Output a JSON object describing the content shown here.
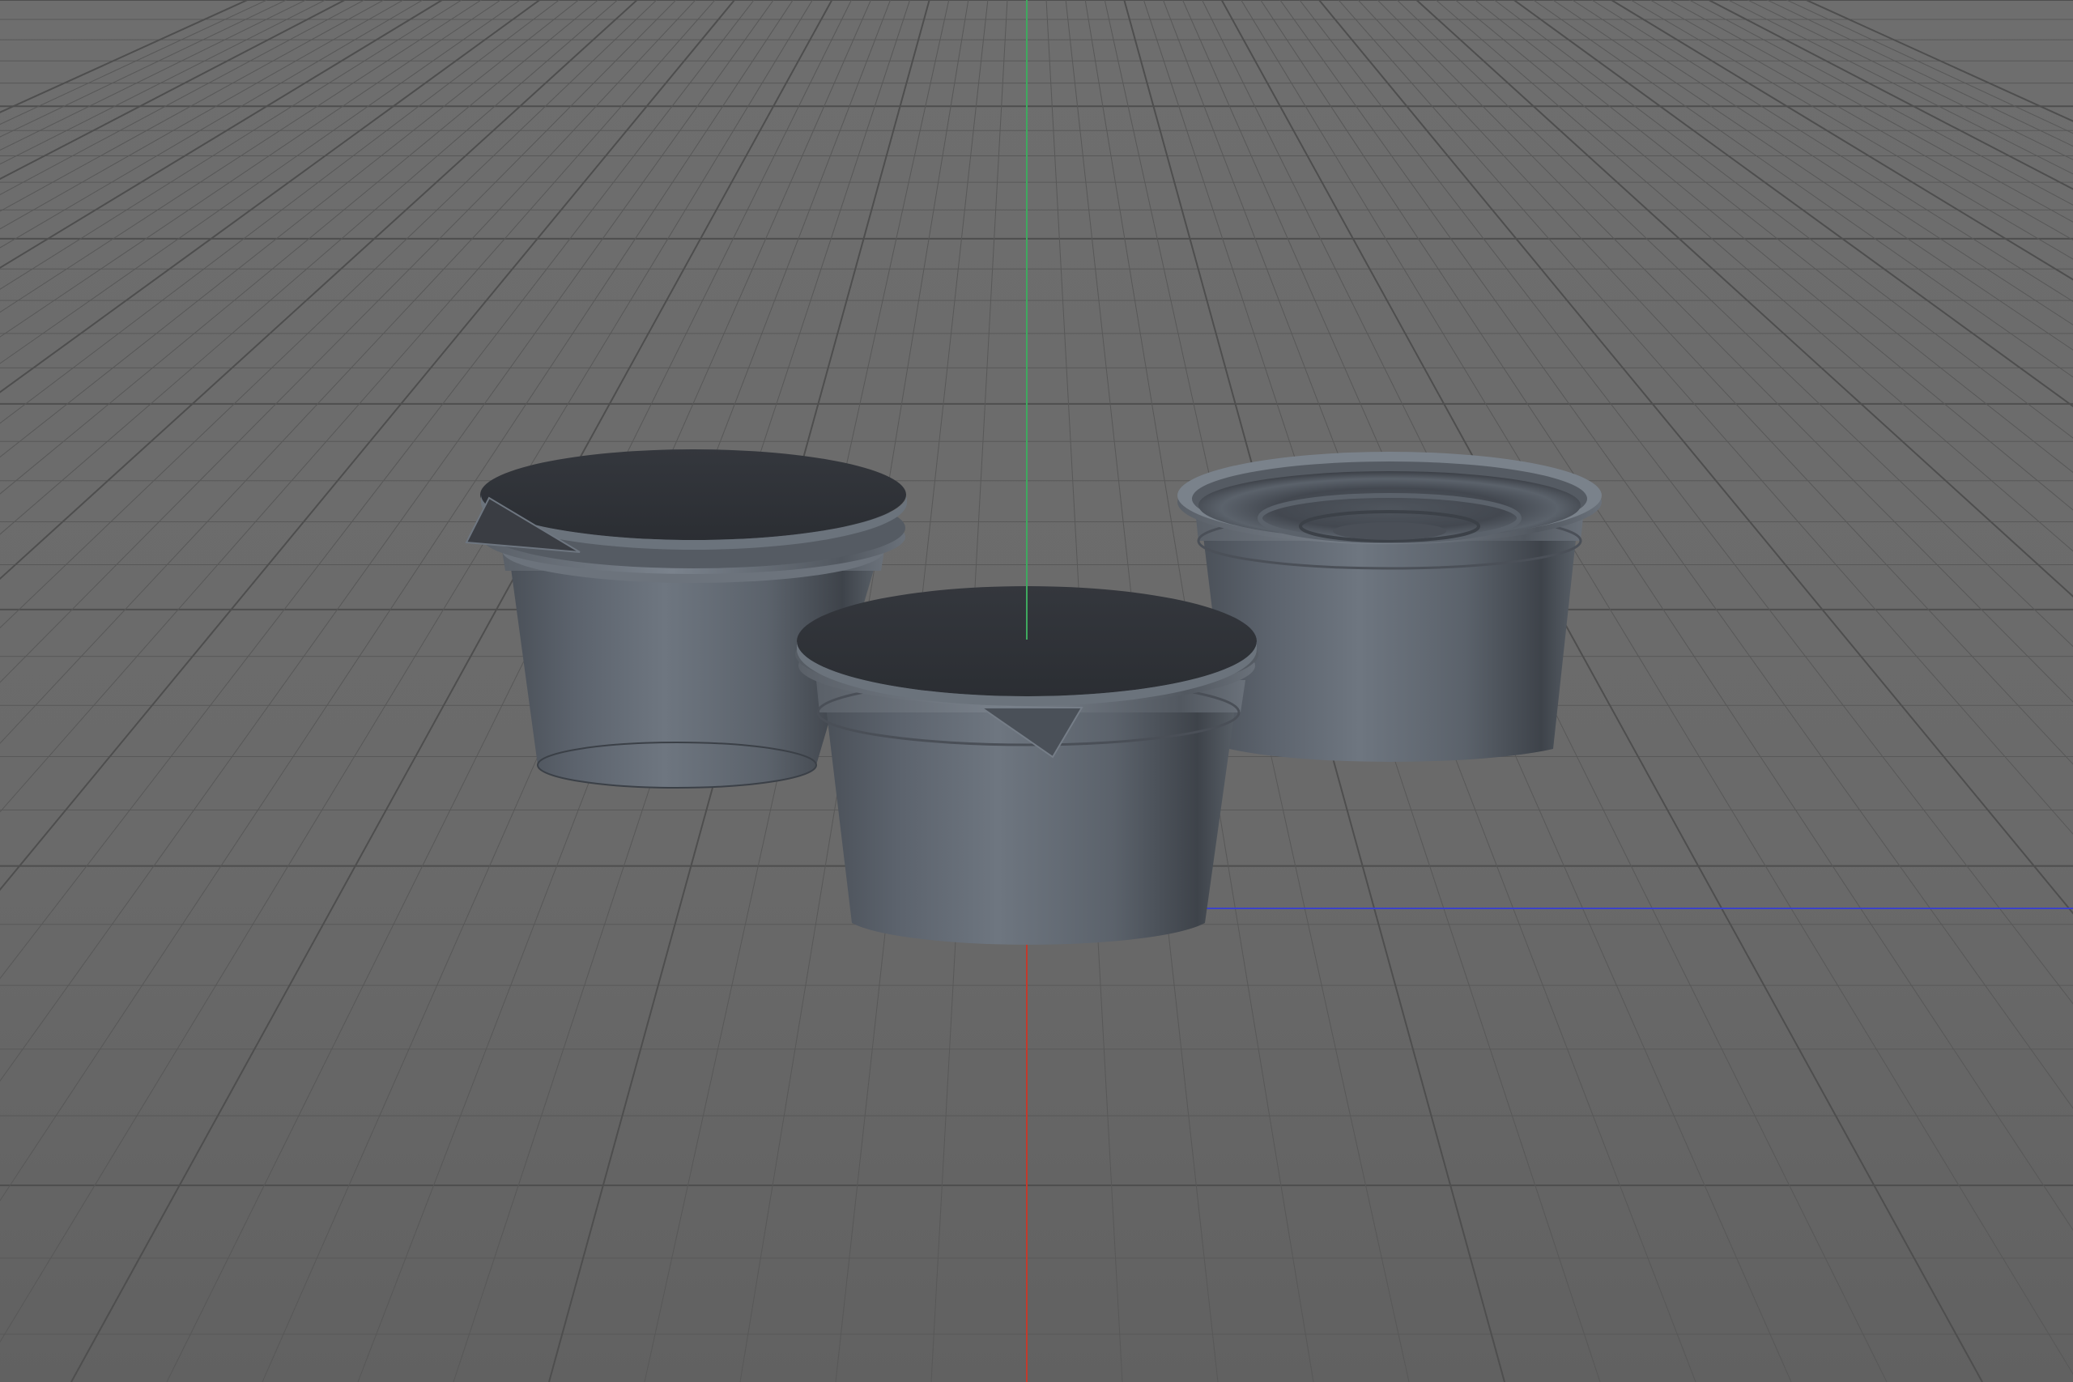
{
  "viewport": {
    "view": "Perspective",
    "background_color": "#6a6a6a",
    "grid_color": "#585858",
    "grid_major_color": "#4e4e4e",
    "axis_colors": {
      "x": "#c23a2c",
      "y": "#3fa95f",
      "z": "#3b42c8"
    },
    "grid": true
  },
  "scene": {
    "objects": [
      {
        "name": "cup-left",
        "state": "sealed-lid",
        "has_tab": true
      },
      {
        "name": "cup-front",
        "state": "sealed-lid",
        "has_tab": true
      },
      {
        "name": "cup-right",
        "state": "open",
        "has_tab": false
      }
    ],
    "material": {
      "body_color": "#5e6570",
      "lid_color": "#2f3238",
      "shade": "clay"
    }
  }
}
